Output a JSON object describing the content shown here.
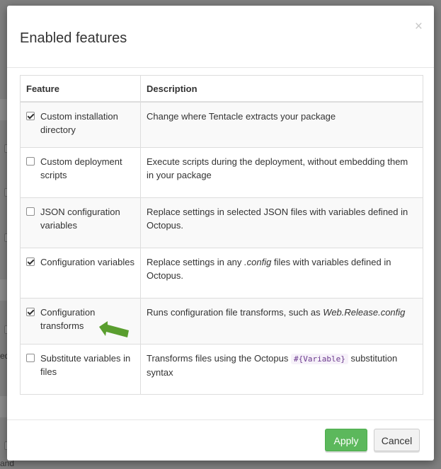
{
  "background": {
    "fragments": [
      "ed",
      "and"
    ]
  },
  "modal": {
    "title": "Enabled features",
    "close_glyph": "×"
  },
  "table": {
    "headers": {
      "feature": "Feature",
      "description": "Description"
    },
    "rows": [
      {
        "feature": "Custom installation directory",
        "checked": true,
        "description": "Change where Tentacle extracts your package"
      },
      {
        "feature": "Custom deployment scripts",
        "checked": false,
        "description": "Execute scripts during the deployment, without embedding them in your package"
      },
      {
        "feature": "JSON configuration variables",
        "checked": false,
        "description": "Replace settings in selected JSON files with variables defined in Octopus."
      },
      {
        "feature": "Configuration variables",
        "checked": true,
        "description_before": "Replace settings in any ",
        "description_em": ".config",
        "description_after": " files with variables defined in Octopus."
      },
      {
        "feature": "Configuration transforms",
        "checked": true,
        "description_before": "Runs configuration file transforms, such as ",
        "description_em": "Web.Release.config",
        "description_after": ""
      },
      {
        "feature": "Substitute variables in files",
        "checked": false,
        "description_before": "Transforms files using the Octopus ",
        "description_code": "#{Variable}",
        "description_after": " substitution syntax"
      }
    ]
  },
  "footer": {
    "apply_label": "Apply",
    "cancel_label": "Cancel"
  },
  "colors": {
    "apply": "#5cb85c",
    "arrow": "#5a9e2f",
    "overlay": "#7f7f7f"
  },
  "icons": {
    "arrow": "pointer-arrow-icon"
  }
}
